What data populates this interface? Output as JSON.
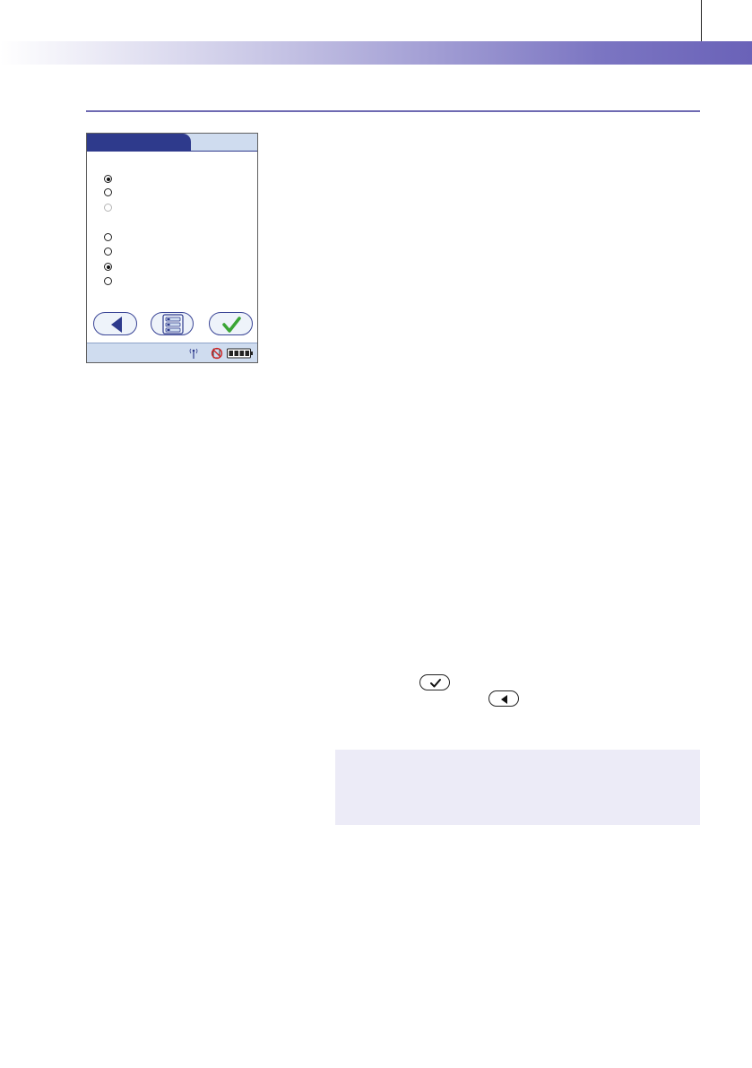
{
  "header": {
    "band_gradient": [
      "#ffffff",
      "#c9c7e6",
      "#7b75c2",
      "#6a62b8"
    ],
    "rule_color": "#6e6ab2"
  },
  "device_screen": {
    "tab_colors": {
      "active": "#2e3a8c",
      "bar": "#cfdcef"
    },
    "radio_options": [
      {
        "state": "checked"
      },
      {
        "state": "unchecked"
      },
      {
        "state": "disabled"
      },
      {
        "state": "unchecked"
      },
      {
        "state": "unchecked"
      },
      {
        "state": "checked"
      },
      {
        "state": "unchecked"
      }
    ],
    "buttons": [
      {
        "name": "back",
        "icon": "triangle-left-icon"
      },
      {
        "name": "menu",
        "icon": "list-menu-icon"
      },
      {
        "name": "confirm",
        "icon": "checkmark-icon",
        "color": "#3aa535"
      }
    ],
    "status_icons": [
      "antenna-icon",
      "no-barcode-icon",
      "battery-icon"
    ]
  },
  "inline_icons": [
    "checkmark-pill-icon",
    "back-triangle-pill-icon"
  ],
  "note_box": {
    "background": "#ecebf7"
  }
}
